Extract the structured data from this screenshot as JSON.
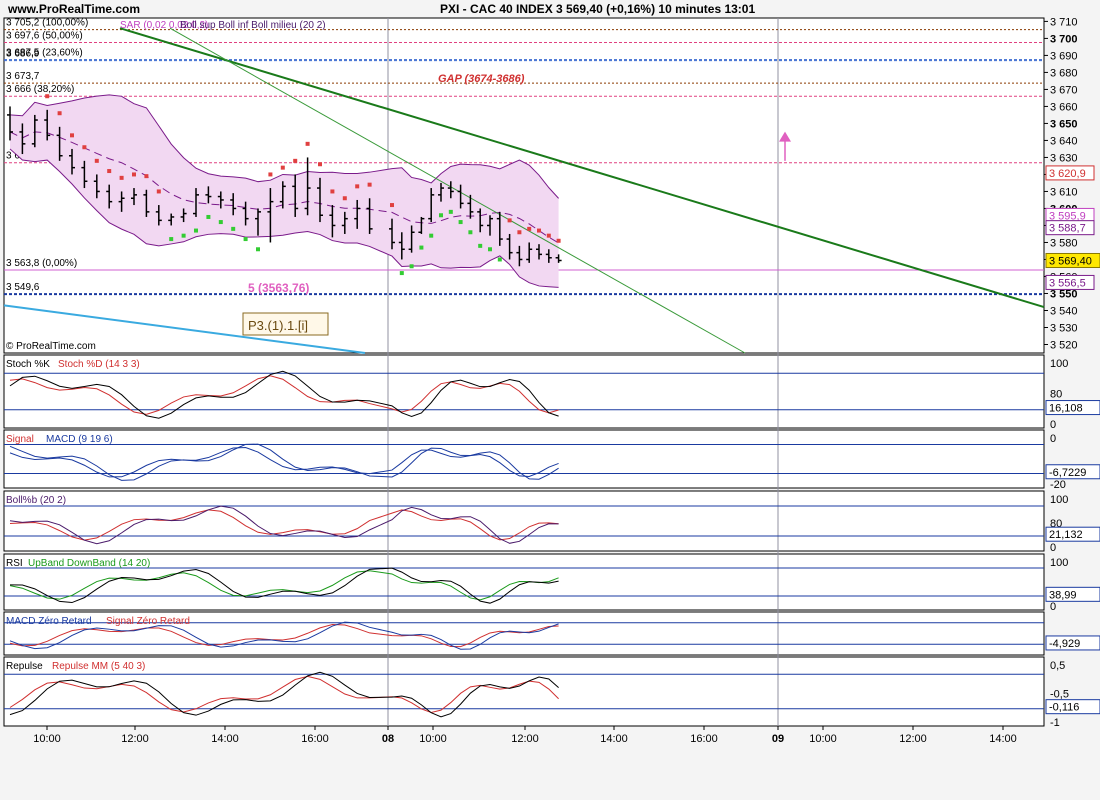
{
  "header": {
    "site": "www.ProRealTime.com",
    "title": "PXI - CAC 40 INDEX    3 569,40 (+0,16%)    10 minutes  13:01"
  },
  "copyright": "© ProRealTime.com",
  "colors": {
    "candle": "#000000",
    "boll_fill": "#f2d8f2",
    "boll_band": "#7a1a8a",
    "sar": "#e04040",
    "sar_up": "#33cc33",
    "trend_main": "#1a7a1a",
    "blue_line": "#3aaae0",
    "stoch_k": "#000000",
    "stoch_d": "#e04040",
    "macd": "#1a3aa0",
    "macd_signal": "#e04040",
    "rsi": "#000000",
    "up_band": "#33cc33",
    "down_band": "#e04040",
    "repulse": "#000000",
    "repulse_mm": "#e04040",
    "current": "#ffe800",
    "fib": "#e04080",
    "support_dotted": "#1a3aa0"
  },
  "price_panel": {
    "legend_boll": "Boll sup Boll inf Boll milieu (20 2)",
    "legend_sar": "SAR (0,02 0,02 0,2)",
    "fib_labels": [
      {
        "text": "3 705,2 (100,00%)",
        "value": 3705.2
      },
      {
        "text": "3 697,6 (50,00%)",
        "value": 3697.6
      },
      {
        "text": "3 687,5 (23,60%)",
        "value": 3687.5
      },
      {
        "text": "3 686,9",
        "value": 3686.9
      },
      {
        "text": "3 673,7",
        "value": 3673.7
      },
      {
        "text": "3 666 (38,20%)",
        "value": 3666
      },
      {
        "text": "3 626,9 (23,60%)",
        "value": 3626.9
      },
      {
        "text": "3 563,8 (0,00%)",
        "value": 3563.8
      },
      {
        "text": "3 549,6",
        "value": 3549.6
      }
    ],
    "gap_label": "GAP (3674-3686)",
    "mid_label": "5 (3563,76)",
    "wave_label": "P3.(1).1.[i]",
    "right_tags": [
      {
        "text": "3 620,9",
        "value": 3620.9
      },
      {
        "text": "3 595,9",
        "value": 3595.9
      },
      {
        "text": "3 588,7",
        "value": 3588.7
      },
      {
        "text": "3 569,40",
        "value": 3569.4
      },
      {
        "text": "3 556,5",
        "value": 3556.5
      }
    ]
  },
  "indicator_panels": [
    {
      "id": "stoch",
      "legend_a": "Stoch %K",
      "legend_b": "Stoch %D (14 3 3)",
      "value_label": "16,108",
      "ticks": [
        "100",
        "80",
        "0"
      ]
    },
    {
      "id": "macd",
      "legend_a": "Signal",
      "legend_b": "MACD (9 19 6)",
      "value_label": "-6,7229",
      "ticks": [
        "0",
        "-20"
      ]
    },
    {
      "id": "bollb",
      "legend_a": "Boll%b (20 2)",
      "legend_b": "",
      "value_label": "21,132",
      "ticks": [
        "100",
        "80",
        "0"
      ]
    },
    {
      "id": "rsi",
      "legend_a": "RSI",
      "legend_b": "UpBand DownBand (14 20)",
      "value_label": "38,99",
      "ticks": [
        "100",
        "0"
      ]
    },
    {
      "id": "macdzr",
      "legend_a": "MACD Zéro Retard",
      "legend_b": "Signal Zéro Retard",
      "value_label": "-4,929",
      "ticks": []
    },
    {
      "id": "repulse",
      "legend_a": "Repulse",
      "legend_b": "Repulse MM (5 40 3)",
      "value_label": "-0,116",
      "ticks": [
        "0,5",
        "-0,5",
        "-1"
      ]
    }
  ],
  "x_axis": {
    "labels": [
      "10:00",
      "12:00",
      "14:00",
      "16:00",
      "08",
      "10:00",
      "12:00",
      "14:00",
      "16:00",
      "09",
      "10:00",
      "12:00",
      "14:00"
    ]
  },
  "chart_data": {
    "type": "candlestick",
    "title": "PXI - CAC 40 INDEX",
    "interval": "10 minutes",
    "ylim": [
      3515,
      3712
    ],
    "y_ticks": [
      3520,
      3530,
      3540,
      3550,
      3560,
      3570,
      3580,
      3590,
      3600,
      3610,
      3620,
      3630,
      3640,
      3650,
      3660,
      3670,
      3680,
      3690,
      3700,
      3710
    ],
    "y_tick_labels": [
      "3 520",
      "3 530",
      "3 540",
      "3 550",
      "3 560",
      "3 570",
      "3 580",
      "3 590",
      "3 600",
      "3 610",
      "3 620",
      "3 630",
      "3 640",
      "3 650",
      "3 660",
      "3 670",
      "3 680",
      "3 690",
      "3 700",
      "3 710"
    ],
    "x_labels": [
      "10:00",
      "12:00",
      "14:00",
      "16:00",
      "08",
      "10:00",
      "12:00",
      "14:00",
      "16:00",
      "09",
      "10:00",
      "12:00",
      "14:00"
    ],
    "ohlc": [
      [
        3655,
        3660,
        3640,
        3645
      ],
      [
        3645,
        3650,
        3632,
        3638
      ],
      [
        3638,
        3655,
        3636,
        3652
      ],
      [
        3652,
        3658,
        3640,
        3643
      ],
      [
        3643,
        3648,
        3628,
        3631
      ],
      [
        3631,
        3635,
        3620,
        3624
      ],
      [
        3624,
        3628,
        3612,
        3616
      ],
      [
        3616,
        3620,
        3606,
        3610
      ],
      [
        3610,
        3614,
        3600,
        3604
      ],
      [
        3604,
        3610,
        3598,
        3606
      ],
      [
        3606,
        3612,
        3602,
        3608
      ],
      [
        3608,
        3611,
        3595,
        3598
      ],
      [
        3598,
        3602,
        3590,
        3593
      ],
      [
        3593,
        3597,
        3590,
        3595
      ],
      [
        3595,
        3600,
        3592,
        3597
      ],
      [
        3597,
        3612,
        3595,
        3608
      ],
      [
        3608,
        3613,
        3603,
        3607
      ],
      [
        3607,
        3610,
        3600,
        3605
      ],
      [
        3605,
        3609,
        3596,
        3600
      ],
      [
        3600,
        3604,
        3590,
        3594
      ],
      [
        3594,
        3600,
        3584,
        3598
      ],
      [
        3598,
        3612,
        3580,
        3604
      ],
      [
        3604,
        3616,
        3600,
        3613
      ],
      [
        3613,
        3620,
        3595,
        3600
      ],
      [
        3600,
        3630,
        3596,
        3612
      ],
      [
        3612,
        3618,
        3592,
        3596
      ],
      [
        3596,
        3602,
        3583,
        3590
      ],
      [
        3590,
        3598,
        3585,
        3594
      ],
      [
        3594,
        3605,
        3588,
        3600
      ],
      [
        3600,
        3606,
        3585,
        3588
      ],
      [
        3588,
        3594,
        3576,
        3580
      ],
      [
        3580,
        3586,
        3570,
        3576
      ],
      [
        3576,
        3590,
        3574,
        3586
      ],
      [
        3586,
        3595,
        3585,
        3594
      ],
      [
        3594,
        3612,
        3592,
        3608
      ],
      [
        3608,
        3615,
        3604,
        3612
      ],
      [
        3612,
        3616,
        3606,
        3610
      ],
      [
        3610,
        3614,
        3600,
        3603
      ],
      [
        3603,
        3608,
        3594,
        3598
      ],
      [
        3598,
        3600,
        3586,
        3590
      ],
      [
        3590,
        3596,
        3584,
        3594
      ],
      [
        3594,
        3598,
        3578,
        3582
      ],
      [
        3582,
        3585,
        3570,
        3574
      ],
      [
        3574,
        3578,
        3566,
        3570
      ],
      [
        3570,
        3580,
        3568,
        3576
      ],
      [
        3576,
        3579,
        3570,
        3573
      ],
      [
        3573,
        3576,
        3568,
        3571
      ],
      [
        3571,
        3573,
        3568,
        3569.4
      ]
    ],
    "indicators": {
      "stoch_k_last": 16.108,
      "macd_last": -6.7229,
      "boll_b_last": 21.132,
      "rsi_last": 38.99,
      "macd_zero_retard_last": -4.929,
      "repulse_last": -0.116
    }
  }
}
